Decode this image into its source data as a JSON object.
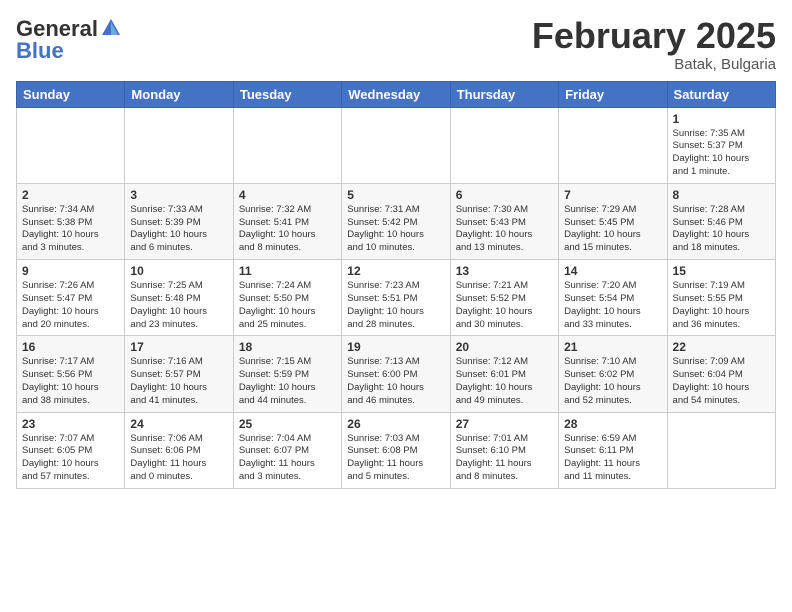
{
  "header": {
    "logo_general": "General",
    "logo_blue": "Blue",
    "month_title": "February 2025",
    "location": "Batak, Bulgaria"
  },
  "weekdays": [
    "Sunday",
    "Monday",
    "Tuesday",
    "Wednesday",
    "Thursday",
    "Friday",
    "Saturday"
  ],
  "weeks": [
    [
      {
        "day": "",
        "info": ""
      },
      {
        "day": "",
        "info": ""
      },
      {
        "day": "",
        "info": ""
      },
      {
        "day": "",
        "info": ""
      },
      {
        "day": "",
        "info": ""
      },
      {
        "day": "",
        "info": ""
      },
      {
        "day": "1",
        "info": "Sunrise: 7:35 AM\nSunset: 5:37 PM\nDaylight: 10 hours\nand 1 minute."
      }
    ],
    [
      {
        "day": "2",
        "info": "Sunrise: 7:34 AM\nSunset: 5:38 PM\nDaylight: 10 hours\nand 3 minutes."
      },
      {
        "day": "3",
        "info": "Sunrise: 7:33 AM\nSunset: 5:39 PM\nDaylight: 10 hours\nand 6 minutes."
      },
      {
        "day": "4",
        "info": "Sunrise: 7:32 AM\nSunset: 5:41 PM\nDaylight: 10 hours\nand 8 minutes."
      },
      {
        "day": "5",
        "info": "Sunrise: 7:31 AM\nSunset: 5:42 PM\nDaylight: 10 hours\nand 10 minutes."
      },
      {
        "day": "6",
        "info": "Sunrise: 7:30 AM\nSunset: 5:43 PM\nDaylight: 10 hours\nand 13 minutes."
      },
      {
        "day": "7",
        "info": "Sunrise: 7:29 AM\nSunset: 5:45 PM\nDaylight: 10 hours\nand 15 minutes."
      },
      {
        "day": "8",
        "info": "Sunrise: 7:28 AM\nSunset: 5:46 PM\nDaylight: 10 hours\nand 18 minutes."
      }
    ],
    [
      {
        "day": "9",
        "info": "Sunrise: 7:26 AM\nSunset: 5:47 PM\nDaylight: 10 hours\nand 20 minutes."
      },
      {
        "day": "10",
        "info": "Sunrise: 7:25 AM\nSunset: 5:48 PM\nDaylight: 10 hours\nand 23 minutes."
      },
      {
        "day": "11",
        "info": "Sunrise: 7:24 AM\nSunset: 5:50 PM\nDaylight: 10 hours\nand 25 minutes."
      },
      {
        "day": "12",
        "info": "Sunrise: 7:23 AM\nSunset: 5:51 PM\nDaylight: 10 hours\nand 28 minutes."
      },
      {
        "day": "13",
        "info": "Sunrise: 7:21 AM\nSunset: 5:52 PM\nDaylight: 10 hours\nand 30 minutes."
      },
      {
        "day": "14",
        "info": "Sunrise: 7:20 AM\nSunset: 5:54 PM\nDaylight: 10 hours\nand 33 minutes."
      },
      {
        "day": "15",
        "info": "Sunrise: 7:19 AM\nSunset: 5:55 PM\nDaylight: 10 hours\nand 36 minutes."
      }
    ],
    [
      {
        "day": "16",
        "info": "Sunrise: 7:17 AM\nSunset: 5:56 PM\nDaylight: 10 hours\nand 38 minutes."
      },
      {
        "day": "17",
        "info": "Sunrise: 7:16 AM\nSunset: 5:57 PM\nDaylight: 10 hours\nand 41 minutes."
      },
      {
        "day": "18",
        "info": "Sunrise: 7:15 AM\nSunset: 5:59 PM\nDaylight: 10 hours\nand 44 minutes."
      },
      {
        "day": "19",
        "info": "Sunrise: 7:13 AM\nSunset: 6:00 PM\nDaylight: 10 hours\nand 46 minutes."
      },
      {
        "day": "20",
        "info": "Sunrise: 7:12 AM\nSunset: 6:01 PM\nDaylight: 10 hours\nand 49 minutes."
      },
      {
        "day": "21",
        "info": "Sunrise: 7:10 AM\nSunset: 6:02 PM\nDaylight: 10 hours\nand 52 minutes."
      },
      {
        "day": "22",
        "info": "Sunrise: 7:09 AM\nSunset: 6:04 PM\nDaylight: 10 hours\nand 54 minutes."
      }
    ],
    [
      {
        "day": "23",
        "info": "Sunrise: 7:07 AM\nSunset: 6:05 PM\nDaylight: 10 hours\nand 57 minutes."
      },
      {
        "day": "24",
        "info": "Sunrise: 7:06 AM\nSunset: 6:06 PM\nDaylight: 11 hours\nand 0 minutes."
      },
      {
        "day": "25",
        "info": "Sunrise: 7:04 AM\nSunset: 6:07 PM\nDaylight: 11 hours\nand 3 minutes."
      },
      {
        "day": "26",
        "info": "Sunrise: 7:03 AM\nSunset: 6:08 PM\nDaylight: 11 hours\nand 5 minutes."
      },
      {
        "day": "27",
        "info": "Sunrise: 7:01 AM\nSunset: 6:10 PM\nDaylight: 11 hours\nand 8 minutes."
      },
      {
        "day": "28",
        "info": "Sunrise: 6:59 AM\nSunset: 6:11 PM\nDaylight: 11 hours\nand 11 minutes."
      },
      {
        "day": "",
        "info": ""
      }
    ]
  ]
}
